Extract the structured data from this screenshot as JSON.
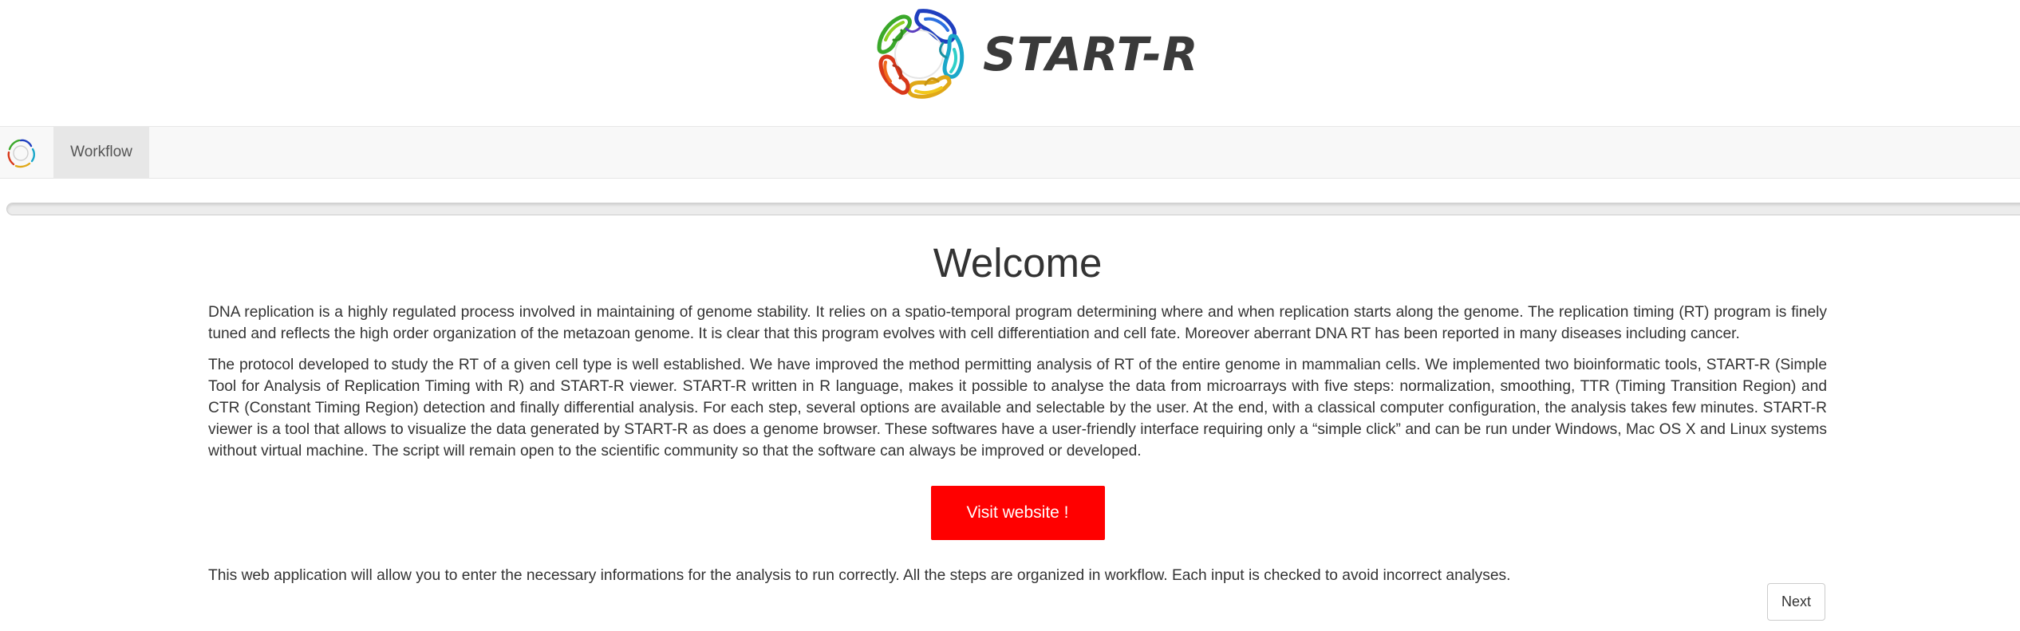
{
  "header": {
    "logo_text": "START-R",
    "logo_icon": "protein-ring-logo"
  },
  "navbar": {
    "brand_icon": "protein-ring-logo",
    "tabs": [
      {
        "label": "Workflow",
        "active": true
      }
    ]
  },
  "progress": {
    "value_percent": 0
  },
  "main": {
    "title": "Welcome",
    "paragraphs": [
      "DNA replication is a highly regulated process involved in maintaining of genome stability. It relies on a spatio-temporal program determining where and when replication starts along the genome. The replication timing (RT) program is finely tuned and reflects the high order organization of the metazoan genome. It is clear that this program evolves with cell differentiation and cell fate. Moreover aberrant DNA RT has been reported in many diseases including cancer.",
      "The protocol developed to study the RT of a given cell type is well established. We have improved the method permitting analysis of RT of the entire genome in mammalian cells. We implemented two bioinformatic tools, START-R (Simple Tool for Analysis of Replication Timing with R) and START-R viewer. START-R written in R language, makes it possible to analyse the data from microarrays with five steps: normalization, smoothing, TTR (Timing Transition Region) and CTR (Constant Timing Region) detection and finally differential analysis. For each step, several options are available and selectable by the user. At the end, with a classical computer configuration, the analysis takes few minutes. START-R viewer is a tool that allows to visualize the data generated by START-R as does a genome browser. These softwares have a user-friendly interface requiring only a “simple click” and can be run under Windows, Mac OS X and Linux systems without virtual machine. The script will remain open to the scientific community so that the software can always be improved or developed.",
      "This web application will allow you to enter the necessary informations for the analysis to run correctly. All the steps are organized in workflow. Each input is checked to avoid incorrect analyses."
    ],
    "visit_button_label": "Visit website !",
    "next_button_label": "Next"
  },
  "colors": {
    "visit_button_bg": "#ff0000",
    "navbar_bg": "#f8f8f8",
    "active_tab_bg": "#e7e7e7",
    "text": "#333333"
  }
}
